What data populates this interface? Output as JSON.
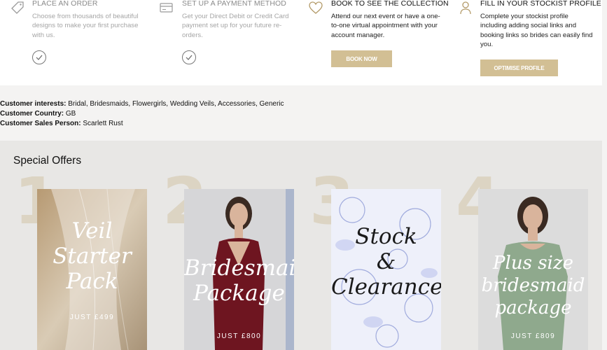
{
  "steps": [
    {
      "title": "PLACE AN ORDER",
      "desc_lines": [
        "Choose from thousands of beautiful",
        "designs to make your first purchase",
        "with us."
      ]
    },
    {
      "title": "SET UP A PAYMENT METHOD",
      "desc_lines": [
        "Get your Direct Debit or Credit Card",
        "payment set up for your future re-",
        "orders."
      ]
    },
    {
      "title": "BOOK TO SEE THE COLLECTION",
      "desc_lines": [
        "Attend our next event or have a one-",
        "to-one virtual appointment with your",
        "account manager."
      ],
      "button": "BOOK NOW"
    },
    {
      "title": "FILL IN YOUR STOCKIST PROFILE",
      "desc_lines": [
        "Complete your stockist profile",
        "including adding social links and",
        "booking links so brides can easily find",
        "you."
      ],
      "button": "OPTIMISE PROFILE"
    }
  ],
  "customer": {
    "interests_label": "Customer interests:",
    "interests_value": " Bridal, Bridesmaids, Flowergirls, Wedding Veils, Accessories, Generic",
    "country_label": "Customer Country:",
    "country_value": " GB",
    "salesperson_label": "Customer Sales Person:",
    "salesperson_value": " Scarlett Rust"
  },
  "offers": {
    "title": "Special Offers",
    "items": [
      {
        "number": "1",
        "lines": [
          "Veil",
          "Starter",
          "Pack"
        ],
        "price": "JUST £499"
      },
      {
        "number": "2",
        "lines": [
          "Bridesmaid",
          "Package"
        ],
        "price": "JUST £800"
      },
      {
        "number": "3",
        "lines": [
          "Stock",
          "&",
          "Clearance"
        ],
        "price": ""
      },
      {
        "number": "4",
        "lines": [
          "Plus size",
          "bridesmaid",
          "package"
        ],
        "price": "JUST £809"
      }
    ]
  },
  "colors": {
    "gold": "#d2bf94",
    "number_tint": "#dcd4c3",
    "band_bg": "#e8e7e5"
  },
  "icons": [
    "tag-icon",
    "credit-card-icon",
    "heart-icon",
    "user-icon",
    "check-icon"
  ]
}
